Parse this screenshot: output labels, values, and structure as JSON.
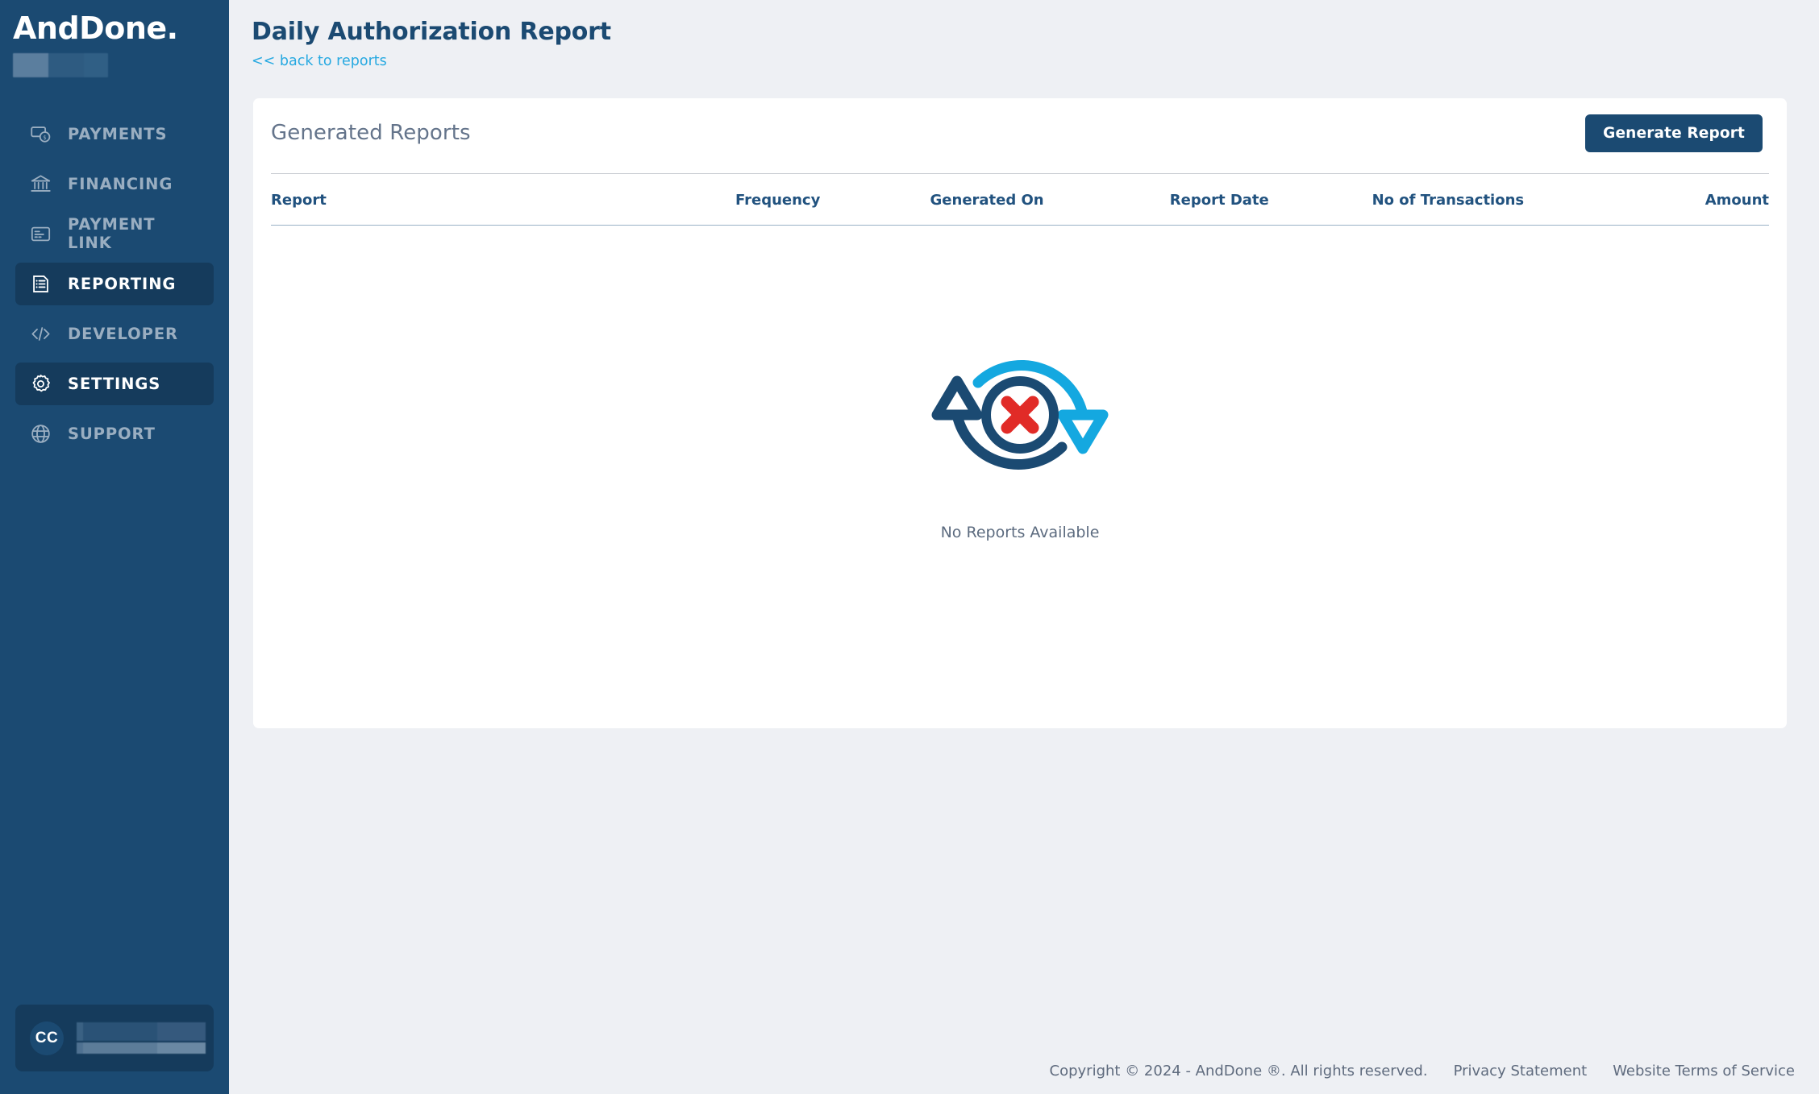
{
  "brand": {
    "name": "AndDone",
    "suffix": ".",
    "redacted_account": ""
  },
  "sidebar": {
    "items": [
      {
        "label": "PAYMENTS",
        "icon": "payments-icon",
        "active": false
      },
      {
        "label": "FINANCING",
        "icon": "bank-icon",
        "active": false
      },
      {
        "label": "PAYMENT LINK",
        "icon": "card-icon",
        "active": false
      },
      {
        "label": "REPORTING",
        "icon": "report-doc-icon",
        "active": true
      },
      {
        "label": "DEVELOPER",
        "icon": "code-icon",
        "active": false
      },
      {
        "label": "SETTINGS",
        "icon": "gear-icon",
        "active": true
      },
      {
        "label": "SUPPORT",
        "icon": "globe-icon",
        "active": false
      }
    ],
    "user": {
      "initials": "CC",
      "name_redacted": "",
      "email_redacted": ""
    }
  },
  "header": {
    "title": "Daily Authorization Report",
    "back_link": "<< back to reports"
  },
  "card": {
    "title": "Generated Reports",
    "generate_button": "Generate Report",
    "table": {
      "columns": [
        "Report",
        "Frequency",
        "Generated On",
        "Report Date",
        "No of Transactions",
        "Amount"
      ],
      "rows": []
    },
    "empty_state": {
      "message": "No Reports Available",
      "illustration": "no-reports-illustration"
    }
  },
  "footer": {
    "copyright": "Copyright © 2024 - AndDone ®. All rights reserved.",
    "privacy_link": "Privacy Statement",
    "terms_link": "Website Terms of Service"
  },
  "colors": {
    "sidebar_bg": "#1b4a72",
    "sidebar_active_bg": "#153b5c",
    "page_bg": "#eef0f4",
    "card_bg": "#ffffff",
    "primary_navy": "#1b4a72",
    "accent_blue": "#27a9e1",
    "illustration_dark": "#1b4a72",
    "illustration_light": "#14a8e0",
    "illustration_red": "#e12b27",
    "muted_text": "#64748b"
  }
}
